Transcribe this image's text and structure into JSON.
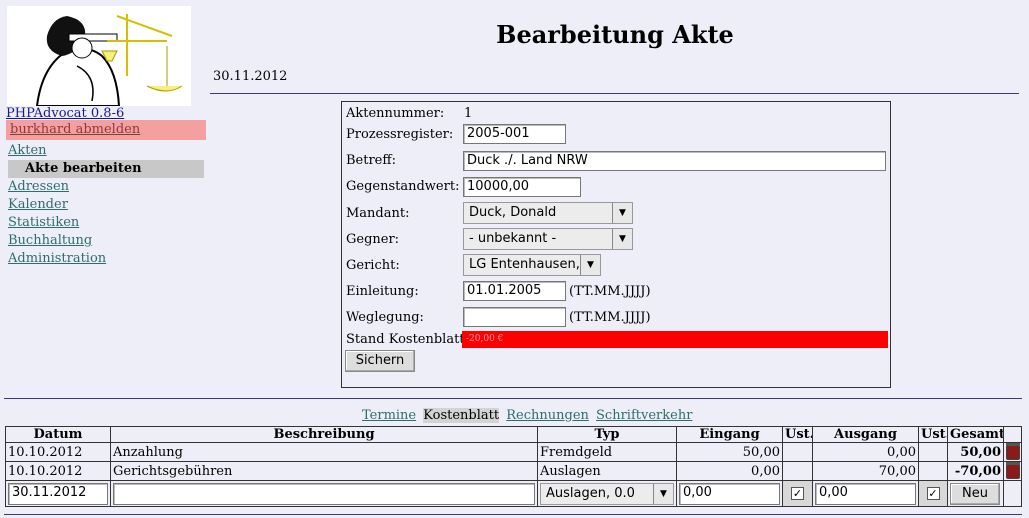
{
  "sidebar": {
    "app_link": "PHPAdvocat 0.8-6",
    "logout": "burkhard abmelden",
    "nav": [
      "Akten",
      "Akte bearbeiten",
      "Adressen",
      "Kalender",
      "Statistiken",
      "Buchhaltung",
      "Administration"
    ],
    "active_nav": "Akte bearbeiten"
  },
  "header": {
    "title": "Bearbeitung Akte",
    "date": "30.11.2012"
  },
  "form": {
    "aktennummer_label": "Aktennummer:",
    "aktennummer": "1",
    "prozessregister_label": "Prozessregister:",
    "prozessregister": "2005-001",
    "betreff_label": "Betreff:",
    "betreff": "Duck ./. Land NRW",
    "gegenstandwert_label": "Gegenstandwert:",
    "gegenstandwert": "10000,00",
    "mandant_label": "Mandant:",
    "mandant": "Duck, Donald",
    "gegner_label": "Gegner:",
    "gegner": "- unbekannt -",
    "gericht_label": "Gericht:",
    "gericht": "LG Entenhausen,",
    "einleitung_label": "Einleitung:",
    "einleitung": "01.01.2005",
    "date_hint": "(TT.MM.JJJJ)",
    "weglegung_label": "Weglegung:",
    "weglegung": "",
    "kostenblatt_label": "Stand Kostenblatt:",
    "kostenblatt_value": "-20,00 €",
    "kostenblatt_color": "#ff0000",
    "save_button": "Sichern"
  },
  "tabs": [
    "Termine",
    "Kostenblatt",
    "Rechnungen",
    "Schriftverkehr"
  ],
  "active_tab": "Kostenblatt",
  "ledger": {
    "columns": [
      "Datum",
      "Beschreibung",
      "Typ",
      "Eingang",
      "Ust.",
      "Ausgang",
      "Ust.",
      "Gesamt"
    ],
    "rows": [
      {
        "datum": "10.10.2012",
        "beschreibung": "Anzahlung",
        "typ": "Fremdgeld",
        "eingang": "50,00",
        "ausgang": "0,00",
        "gesamt": "50,00"
      },
      {
        "datum": "10.10.2012",
        "beschreibung": "Gerichtsgebühren",
        "typ": "Auslagen",
        "eingang": "0,00",
        "ausgang": "70,00",
        "gesamt": "-70,00"
      }
    ],
    "new_entry": {
      "datum": "30.11.2012",
      "beschreibung": "",
      "typ": "Auslagen, 0.0",
      "eingang": "0,00",
      "ausgang": "0,00",
      "button": "Neu"
    }
  }
}
